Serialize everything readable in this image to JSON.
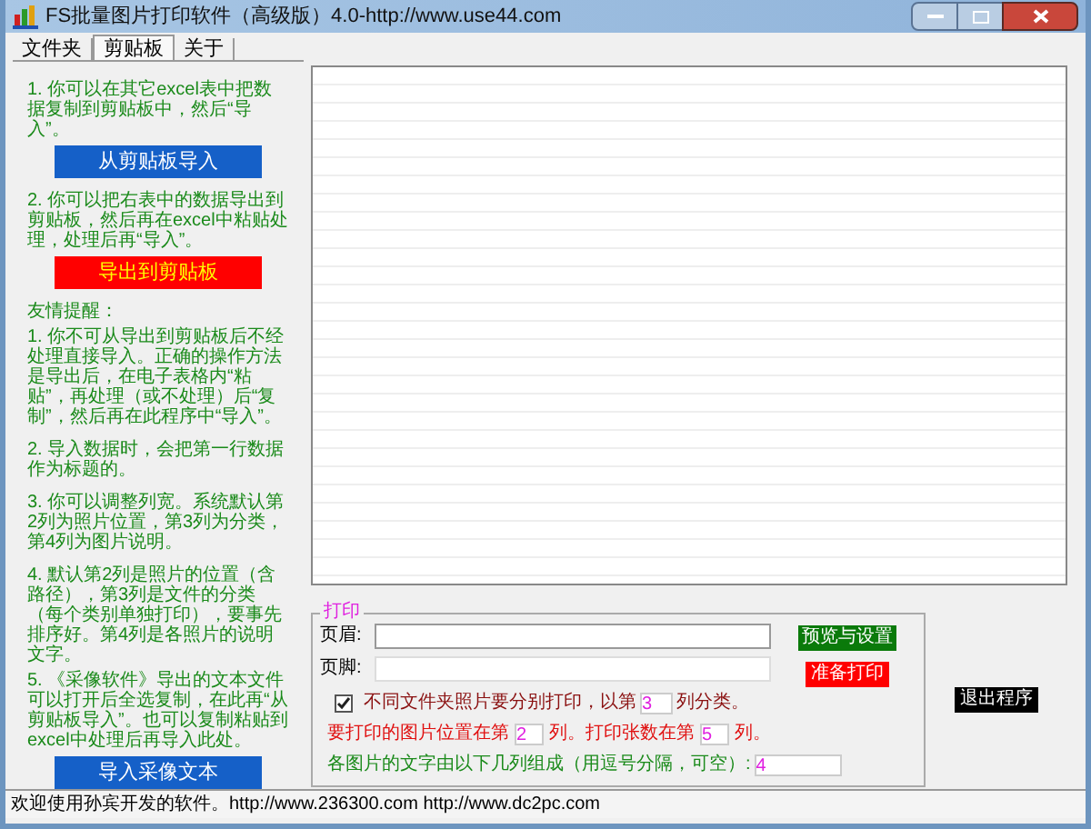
{
  "window": {
    "title": "FS批量图片打印软件（高级版）4.0-http://www.use44.com"
  },
  "tabs": [
    {
      "label": "文件夹",
      "selected": false
    },
    {
      "label": "剪贴板",
      "selected": true
    },
    {
      "label": "关于",
      "selected": false
    }
  ],
  "left_panel": [
    {
      "kind": "text",
      "text": "1. 你可以在其它excel表中把数据复制到剪贴板中，然后“导入”。"
    },
    {
      "kind": "button",
      "text": "从剪贴板导入",
      "color": "#1560c8"
    },
    {
      "kind": "text",
      "text": "2. 你可以把右表中的数据导出到剪贴板，然后再在excel中粘贴处理，处理后再“导入”。"
    },
    {
      "kind": "button",
      "text": "导出到剪贴板",
      "color": "#ff0000"
    },
    {
      "kind": "heading",
      "text": "友情提醒："
    },
    {
      "kind": "note",
      "text": "1. 你不可从导出到剪贴板后不经处理直接导入。正确的操作方法是导出后，在电子表格内“粘贴”，再处理（或不处理）后“复制”，然后再在此程序中“导入”。"
    },
    {
      "kind": "text",
      "text": "2. 导入数据时，会把第一行数据作为标题的。"
    },
    {
      "kind": "text",
      "text": "3. 你可以调整列宽。系统默认第2列为照片位置，第3列为分类，第4列为图片说明。"
    },
    {
      "kind": "text",
      "text": "4. 默认第2列是照片的位置（含路径），第3列是文件的分类（每个类别单独打印），要事先排序好。第4列是各照片的说明文字。"
    },
    {
      "kind": "note",
      "text": "5. 《采像软件》导出的文本文件可以打开后全选复制，在此再“从剪贴板导入”。也可以复制粘贴到excel中处理后再导入此处。"
    },
    {
      "kind": "button",
      "text": "导入采像文本",
      "color": "#1560c8"
    }
  ],
  "print_group": {
    "legend": "打印",
    "header_label": "页眉:",
    "footer_label": "页脚:",
    "separate_checkbox": {
      "checked": true,
      "label": "不同文件夹照片要分别打印，以第",
      "value": "3",
      "suffix": "列分类。"
    },
    "position_row": {
      "label": "要打印的图片位置在第",
      "position_value": "2",
      "middle": "列。打印张数在第",
      "count_value": "5",
      "suffix": "列。"
    },
    "text_row": {
      "label": "各图片的文字由以下几列组成（用逗号分隔，可空）:",
      "value": "4"
    },
    "preview_button": "预览与设置",
    "print_button": "准备打印"
  },
  "exit_button": "退出程序",
  "status_bar": "欢迎使用孙宾开发的软件。http://www.236300.com http://www.dc2pc.com"
}
